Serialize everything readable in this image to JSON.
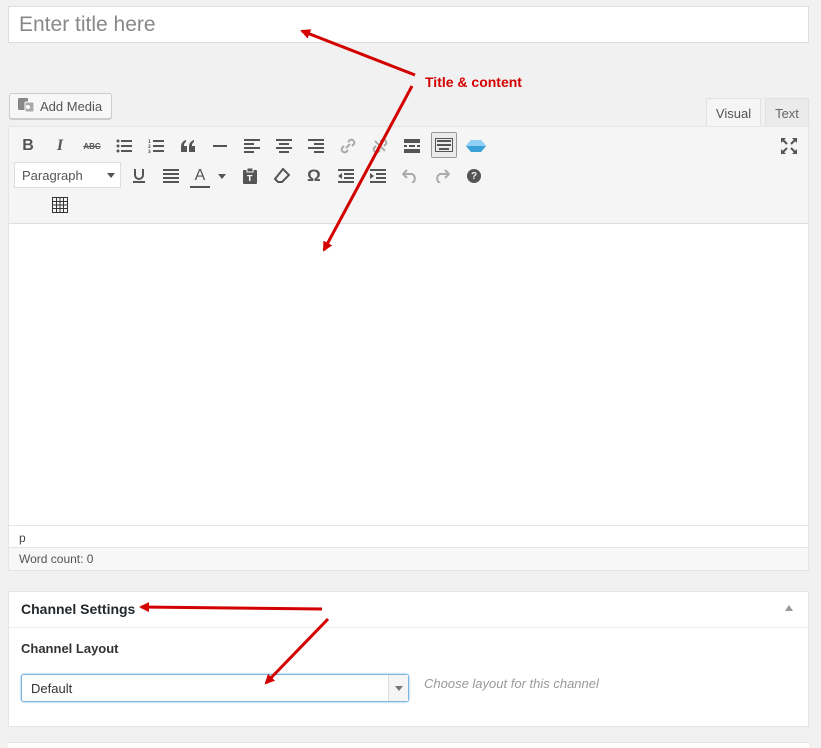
{
  "title_field": {
    "placeholder": "Enter title here"
  },
  "media": {
    "add_media_label": "Add Media"
  },
  "editor_tabs": {
    "visual": "Visual",
    "text": "Text"
  },
  "toolbar": {
    "row1": [
      "bold",
      "italic",
      "strikethrough",
      "bullet-list",
      "numbered-list",
      "blockquote",
      "horizontal-rule",
      "align-left",
      "align-center",
      "align-right",
      "insert-link",
      "remove-link",
      "read-more",
      "toolbar-toggle",
      "plugin"
    ],
    "format_select": "Paragraph",
    "row2": [
      "underline",
      "justify",
      "text-color",
      "paste-as-text",
      "clear-formatting",
      "special-character",
      "outdent",
      "indent",
      "undo",
      "redo",
      "help"
    ],
    "row3": [
      "insert-table"
    ],
    "bold": "B",
    "italic": "I",
    "strike": "ABC",
    "text_color": "A",
    "omega": "Ω",
    "help": "?"
  },
  "status": {
    "path": "p",
    "word_count": "Word count: 0"
  },
  "channel_settings": {
    "title": "Channel Settings",
    "layout_label": "Channel Layout",
    "layout_value": "Default",
    "layout_hint": "Choose layout for this channel"
  },
  "annotation": {
    "text": "Title & content",
    "color": "#d30000"
  }
}
